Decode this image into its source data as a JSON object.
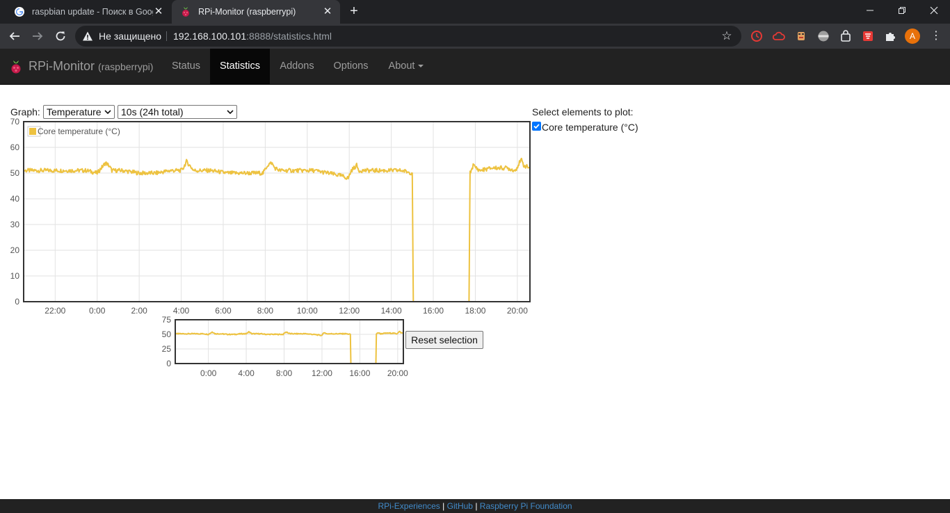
{
  "browser": {
    "tabs": [
      {
        "title": "raspbian update - Поиск в Goog",
        "active": false,
        "icon": "google-icon"
      },
      {
        "title": "RPi-Monitor (raspberrypi)",
        "active": true,
        "icon": "raspberry-icon"
      }
    ],
    "security_label": "Не защищено",
    "url_host": "192.168.100.101",
    "url_rest": ":8888/statistics.html",
    "profile_initial": "A"
  },
  "app": {
    "brand": "RPi-Monitor",
    "host": "(raspberrypi)",
    "nav": [
      {
        "label": "Status",
        "active": false
      },
      {
        "label": "Statistics",
        "active": true
      },
      {
        "label": "Addons",
        "active": false
      },
      {
        "label": "Options",
        "active": false
      },
      {
        "label": "About",
        "active": false,
        "dropdown": true
      }
    ]
  },
  "controls": {
    "graph_label": "Graph:",
    "graph_select": "Temperature",
    "period_select": "10s (24h total)",
    "select_elements_label": "Select elements to plot:",
    "element_label": "Core temperature (°C)",
    "element_checked": true,
    "reset_label": "Reset selection"
  },
  "chart_data": [
    {
      "type": "line",
      "role": "main",
      "color": "#edc240",
      "legend": "Core temperature (°C)",
      "legend_position": "top-left",
      "grid": true,
      "x_range_hours": [
        20.5,
        44.6
      ],
      "ylim": [
        0,
        70
      ],
      "y_ticks": [
        0,
        10,
        20,
        30,
        40,
        50,
        60,
        70
      ],
      "x_ticks": [
        {
          "h": 22,
          "label": "22:00"
        },
        {
          "h": 24,
          "label": "0:00"
        },
        {
          "h": 26,
          "label": "2:00"
        },
        {
          "h": 28,
          "label": "4:00"
        },
        {
          "h": 30,
          "label": "6:00"
        },
        {
          "h": 32,
          "label": "8:00"
        },
        {
          "h": 34,
          "label": "10:00"
        },
        {
          "h": 36,
          "label": "12:00"
        },
        {
          "h": 38,
          "label": "14:00"
        },
        {
          "h": 40,
          "label": "16:00"
        },
        {
          "h": 42,
          "label": "18:00"
        },
        {
          "h": 44,
          "label": "20:00"
        }
      ],
      "series": [
        {
          "name": "Core temperature (°C)",
          "points": [
            [
              20.5,
              51
            ],
            [
              21.2,
              51
            ],
            [
              22.0,
              51
            ],
            [
              22.8,
              51
            ],
            [
              23.5,
              51
            ],
            [
              24.0,
              50
            ],
            [
              24.2,
              52
            ],
            [
              24.4,
              54
            ],
            [
              24.55,
              53
            ],
            [
              24.7,
              51
            ],
            [
              25.2,
              51
            ],
            [
              26.0,
              50
            ],
            [
              26.8,
              50
            ],
            [
              27.5,
              51
            ],
            [
              28.0,
              51
            ],
            [
              28.1,
              52
            ],
            [
              28.25,
              54.5
            ],
            [
              28.4,
              53
            ],
            [
              28.6,
              51
            ],
            [
              29.4,
              51
            ],
            [
              30.2,
              50
            ],
            [
              31.0,
              50
            ],
            [
              31.9,
              50
            ],
            [
              32.1,
              53
            ],
            [
              32.3,
              54
            ],
            [
              32.45,
              52
            ],
            [
              32.7,
              51
            ],
            [
              33.5,
              51
            ],
            [
              34.3,
              51
            ],
            [
              35.0,
              50
            ],
            [
              35.6,
              49
            ],
            [
              35.95,
              48
            ],
            [
              36.1,
              51
            ],
            [
              36.35,
              53
            ],
            [
              36.45,
              51
            ],
            [
              37.0,
              51
            ],
            [
              37.8,
              51
            ],
            [
              38.5,
              51
            ],
            [
              39.0,
              50
            ],
            [
              39.05,
              0
            ],
            [
              41.7,
              0
            ],
            [
              41.75,
              50
            ],
            [
              41.9,
              53
            ],
            [
              42.2,
              51
            ],
            [
              42.8,
              52
            ],
            [
              43.5,
              52
            ],
            [
              43.9,
              51
            ],
            [
              44.1,
              54
            ],
            [
              44.2,
              55
            ],
            [
              44.3,
              53
            ],
            [
              44.6,
              52
            ]
          ]
        }
      ]
    },
    {
      "type": "line",
      "role": "overview",
      "color": "#edc240",
      "grid": true,
      "x_range_hours": [
        20.5,
        44.6
      ],
      "ylim": [
        0,
        75
      ],
      "y_ticks": [
        0,
        25,
        50,
        75
      ],
      "x_ticks": [
        {
          "h": 24,
          "label": "0:00"
        },
        {
          "h": 28,
          "label": "4:00"
        },
        {
          "h": 32,
          "label": "8:00"
        },
        {
          "h": 36,
          "label": "12:00"
        },
        {
          "h": 40,
          "label": "16:00"
        },
        {
          "h": 44,
          "label": "20:00"
        }
      ]
    }
  ],
  "footer": {
    "link1": "RPi-Experiences",
    "link2": "GitHub",
    "link3": "Raspberry Pi Foundation",
    "sep": "|"
  }
}
